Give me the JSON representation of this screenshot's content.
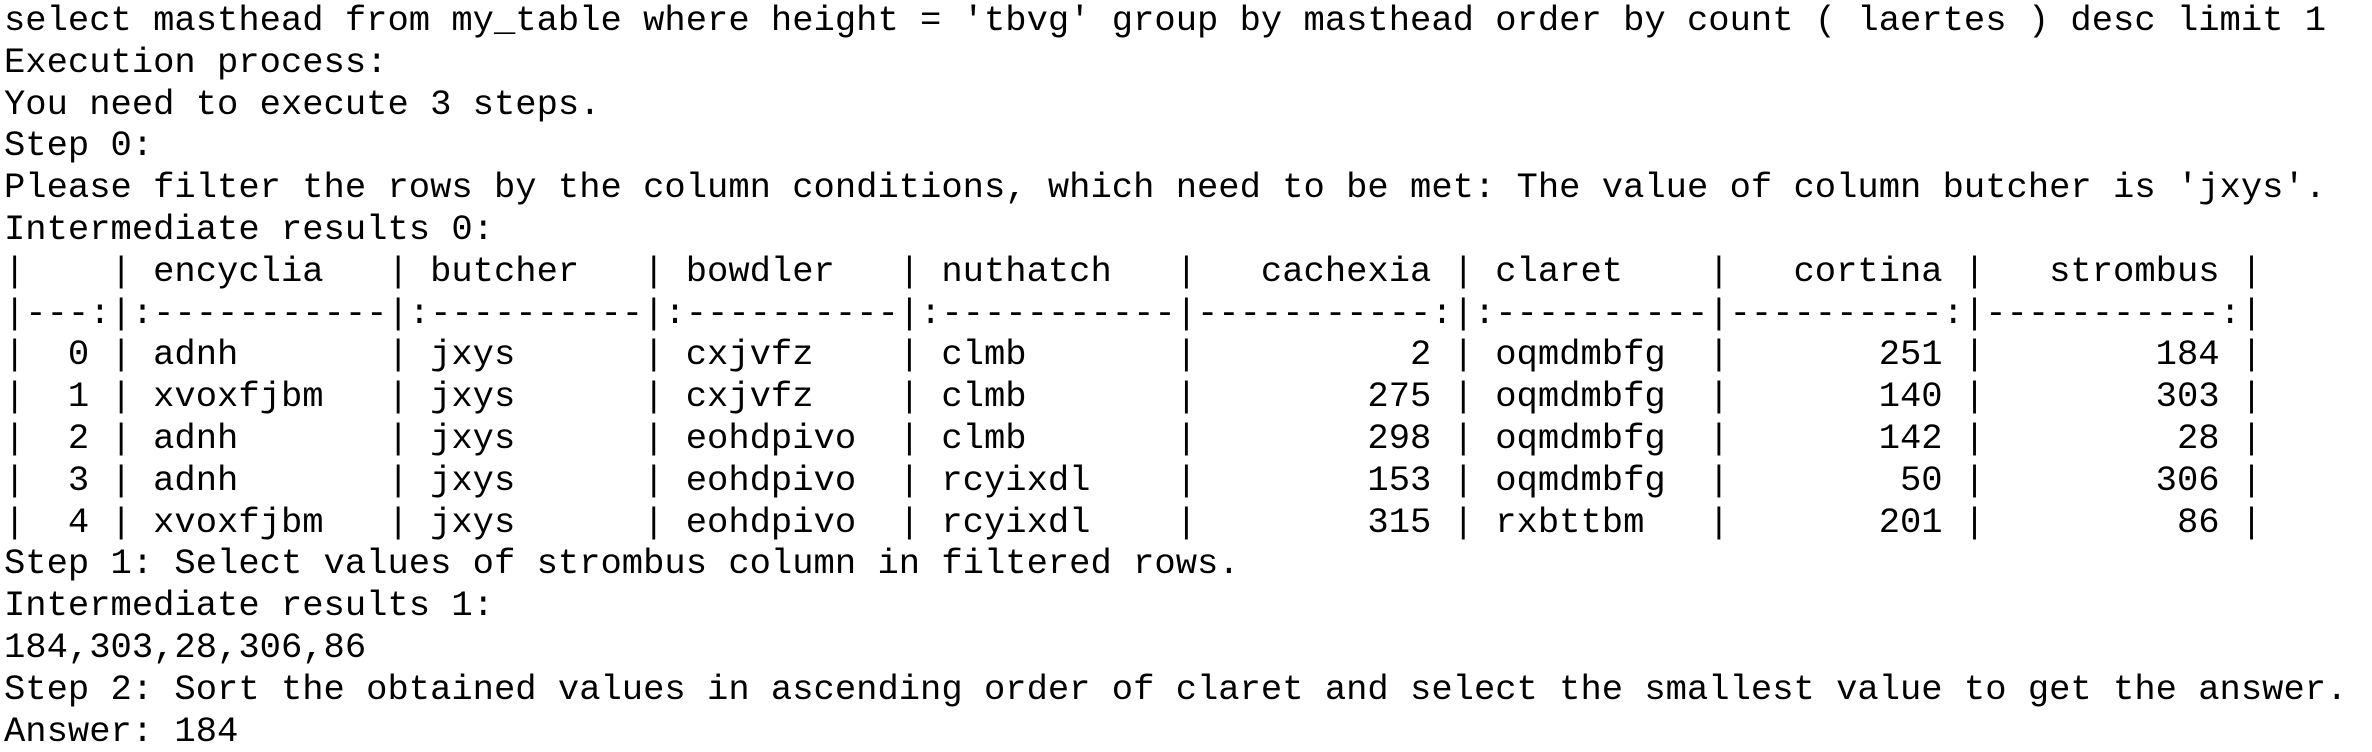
{
  "query": "select masthead from my_table where height = 'tbvg' group by masthead order by count ( laertes ) desc limit 1",
  "execution_header": "Execution process:",
  "steps_intro": "You need to execute 3 steps.",
  "step0": {
    "title": "Step 0:",
    "description": "Please filter the rows by the column conditions, which need to be met: The value of column butcher is 'jxys'.",
    "results_label": "Intermediate results 0:",
    "table": {
      "header": "|    | encyclia   | butcher   | bowdler   | nuthatch   |   cachexia | claret    |   cortina |   strombus |",
      "separator": "|---:|:-----------|:----------|:----------|:-----------|-----------:|:----------|----------:|-----------:|",
      "rows": [
        "|  0 | adnh       | jxys      | cxjvfz    | clmb       |          2 | oqmdmbfg  |       251 |        184 |",
        "|  1 | xvoxfjbm   | jxys      | cxjvfz    | clmb       |        275 | oqmdmbfg  |       140 |        303 |",
        "|  2 | adnh       | jxys      | eohdpivo  | clmb       |        298 | oqmdmbfg  |       142 |         28 |",
        "|  3 | adnh       | jxys      | eohdpivo  | rcyixdl    |        153 | oqmdmbfg  |        50 |        306 |",
        "|  4 | xvoxfjbm   | jxys      | eohdpivo  | rcyixdl    |        315 | rxbttbm   |       201 |         86 |"
      ]
    }
  },
  "step1": {
    "title": "Step 1: Select values of strombus column in filtered rows.",
    "results_label": "Intermediate results 1:",
    "results": "184,303,28,306,86"
  },
  "step2": {
    "title": "Step 2: Sort the obtained values in ascending order of claret and select the smallest value to get the answer."
  },
  "answer": "Answer: 184"
}
